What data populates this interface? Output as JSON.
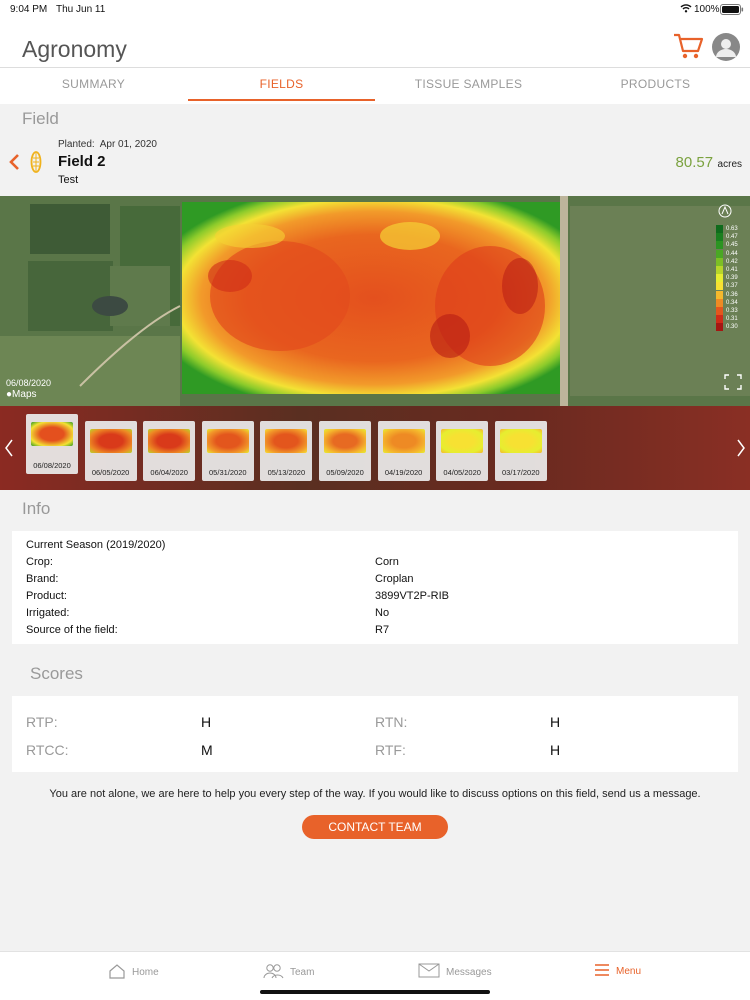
{
  "status_bar": {
    "time": "9:04 PM",
    "date": "Thu Jun 11",
    "battery": "100%"
  },
  "header": {
    "title": "Agronomy"
  },
  "tabs": [
    {
      "label": "SUMMARY",
      "active": false
    },
    {
      "label": "FIELDS",
      "active": true
    },
    {
      "label": "TISSUE SAMPLES",
      "active": false
    },
    {
      "label": "PRODUCTS",
      "active": false
    }
  ],
  "field_section": {
    "title": "Field"
  },
  "field": {
    "planted_label": "Planted:",
    "planted_date": "Apr 01, 2020",
    "name": "Field 2",
    "subtitle": "Test",
    "acres_value": "80.57",
    "acres_unit": "acres"
  },
  "map": {
    "date": "06/08/2020",
    "attribution": "Maps",
    "legend": [
      {
        "value": "0.63",
        "color": "#0f6b1c"
      },
      {
        "value": "0.47",
        "color": "#1a7f1f"
      },
      {
        "value": "0.45",
        "color": "#2c9422"
      },
      {
        "value": "0.44",
        "color": "#4aa824"
      },
      {
        "value": "0.42",
        "color": "#7cbf25"
      },
      {
        "value": "0.41",
        "color": "#b6d62a"
      },
      {
        "value": "0.39",
        "color": "#e6ee30"
      },
      {
        "value": "0.37",
        "color": "#f7e132"
      },
      {
        "value": "0.36",
        "color": "#f5b82d"
      },
      {
        "value": "0.34",
        "color": "#ee8a24"
      },
      {
        "value": "0.33",
        "color": "#e3561d"
      },
      {
        "value": "0.31",
        "color": "#cf2b18"
      },
      {
        "value": "0.30",
        "color": "#a51612"
      }
    ]
  },
  "thumbnails": [
    {
      "date": "06/08/2020",
      "selected": true
    },
    {
      "date": "06/05/2020",
      "selected": false
    },
    {
      "date": "06/04/2020",
      "selected": false
    },
    {
      "date": "05/31/2020",
      "selected": false
    },
    {
      "date": "05/13/2020",
      "selected": false
    },
    {
      "date": "05/09/2020",
      "selected": false
    },
    {
      "date": "04/19/2020",
      "selected": false
    },
    {
      "date": "04/05/2020",
      "selected": false
    },
    {
      "date": "03/17/2020",
      "selected": false
    }
  ],
  "info": {
    "title": "Info",
    "season": "Current Season (2019/2020)",
    "rows": [
      {
        "label": "Crop:",
        "value": "Corn"
      },
      {
        "label": "Brand:",
        "value": "Croplan"
      },
      {
        "label": "Product:",
        "value": "3899VT2P-RIB"
      },
      {
        "label": "Irrigated:",
        "value": "No"
      },
      {
        "label": "Source of the field:",
        "value": "R7"
      }
    ]
  },
  "scores": {
    "title": "Scores",
    "items": [
      {
        "label": "RTP:",
        "value": "H"
      },
      {
        "label": "RTN:",
        "value": "H"
      },
      {
        "label": "RTCC:",
        "value": "M"
      },
      {
        "label": "RTF:",
        "value": "H"
      }
    ]
  },
  "message": "You are not alone, we are here to help you every step of the way. If you would like to discuss options on this field, send us a message.",
  "contact_button": "CONTACT TEAM",
  "bottom_nav": [
    {
      "label": "Home",
      "icon": "home-icon",
      "active": false
    },
    {
      "label": "Team",
      "icon": "team-icon",
      "active": false
    },
    {
      "label": "Messages",
      "icon": "envelope-icon",
      "active": false
    },
    {
      "label": "Menu",
      "icon": "menu-icon",
      "active": true
    }
  ],
  "colors": {
    "accent": "#e8622a",
    "acres": "#7ba23f"
  }
}
